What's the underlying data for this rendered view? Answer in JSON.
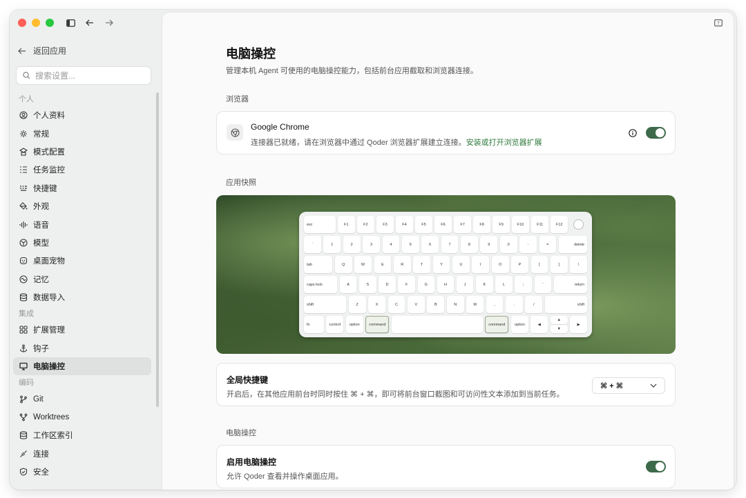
{
  "window": {
    "traffic_colors": [
      "#fe5f57",
      "#febc2e",
      "#28c840"
    ]
  },
  "sidebar": {
    "back_label": "返回应用",
    "search_placeholder": "搜索设置...",
    "sections": [
      {
        "label": "个人",
        "items": [
          {
            "label": "个人资料",
            "icon": "user-circle-icon"
          },
          {
            "label": "常规",
            "icon": "gear-icon"
          },
          {
            "label": "模式配置",
            "icon": "modes-icon"
          },
          {
            "label": "任务监控",
            "icon": "task-list-icon"
          },
          {
            "label": "快捷键",
            "icon": "keyboard-icon"
          },
          {
            "label": "外观",
            "icon": "paint-bucket-icon"
          },
          {
            "label": "语音",
            "icon": "waveform-icon"
          },
          {
            "label": "模型",
            "icon": "model-icon"
          },
          {
            "label": "桌面宠物",
            "icon": "pet-icon"
          },
          {
            "label": "记忆",
            "icon": "memory-icon"
          },
          {
            "label": "数据导入",
            "icon": "database-icon"
          }
        ]
      },
      {
        "label": "集成",
        "items": [
          {
            "label": "扩展管理",
            "icon": "extensions-icon"
          },
          {
            "label": "钩子",
            "icon": "anchor-icon"
          },
          {
            "label": "电脑操控",
            "icon": "monitor-icon",
            "active": true
          }
        ]
      },
      {
        "label": "编码",
        "items": [
          {
            "label": "Git",
            "icon": "git-branch-icon"
          },
          {
            "label": "Worktrees",
            "icon": "worktree-icon"
          },
          {
            "label": "工作区索引",
            "icon": "database-icon"
          },
          {
            "label": "连接",
            "icon": "connection-icon"
          },
          {
            "label": "安全",
            "icon": "shield-icon"
          }
        ]
      }
    ]
  },
  "main": {
    "title": "电脑操控",
    "description": "管理本机 Agent 可使用的电脑操控能力，包括前台应用截取和浏览器连接。",
    "browser_section": "浏览器",
    "browser_card": {
      "name": "Google Chrome",
      "desc": "连接器已就绪，请在浏览器中通过 Qoder 浏览器扩展建立连接。",
      "link": "安装或打开浏览器扩展",
      "enabled": true
    },
    "snapshot_section": "应用快照",
    "keyboard": {
      "rows": [
        [
          "esc",
          "F1",
          "F2",
          "F3",
          "F4",
          "F5",
          "F6",
          "F7",
          "F8",
          "F9",
          "F10",
          "F11",
          "F12",
          ""
        ],
        [
          "`",
          "1",
          "2",
          "3",
          "4",
          "5",
          "6",
          "7",
          "8",
          "9",
          "0",
          "-",
          "=",
          "delete"
        ],
        [
          "tab",
          "Q",
          "W",
          "E",
          "R",
          "T",
          "Y",
          "U",
          "I",
          "O",
          "P",
          "[",
          "]",
          "\\"
        ],
        [
          "caps lock",
          "A",
          "S",
          "D",
          "F",
          "G",
          "H",
          "J",
          "K",
          "L",
          ";",
          "'",
          "return"
        ],
        [
          "shift",
          "Z",
          "X",
          "C",
          "V",
          "B",
          "N",
          "M",
          ",",
          ".",
          "/",
          "shift"
        ],
        [
          "fn",
          "control",
          "option",
          "command",
          "",
          "command",
          "option",
          "◀",
          "▲▼",
          "▶"
        ]
      ]
    },
    "shortcut_card": {
      "title": "全局快捷键",
      "desc": "开启后，在其他应用前台时同时按住 ⌘ + ⌘，即可将前台窗口截图和可访问性文本添加到当前任务。",
      "value": "⌘ + ⌘"
    },
    "control_section": "电脑操控",
    "control_card": {
      "title": "启用电脑操控",
      "desc": "允许 Qoder 查看并操作桌面应用。",
      "enabled": true
    }
  }
}
